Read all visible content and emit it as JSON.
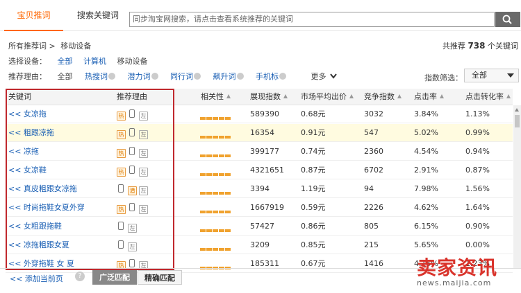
{
  "tabs": {
    "active": "宝贝推词",
    "inactive": "搜索关键词"
  },
  "search": {
    "placeholder": "同步淘宝网搜索，请点击查看系统推荐的关键词"
  },
  "breadcrumb": {
    "root": "所有推荐词 >",
    "current": "移动设备"
  },
  "total": {
    "prefix": "共推荐",
    "count": "738",
    "suffix": "个关键词"
  },
  "device": {
    "label": "选择设备：",
    "options": [
      "全部",
      "计算机",
      "移动设备"
    ]
  },
  "reason": {
    "label": "推荐理由：",
    "all": "全部",
    "options": [
      "热搜词",
      "潜力词",
      "同行词",
      "飙升词",
      "手机标"
    ],
    "more": "更多"
  },
  "index_filter": {
    "label": "指数筛选：",
    "value": "全部"
  },
  "columns": [
    "关键词",
    "推荐理由",
    "相关性",
    "展现指数",
    "市场平均出价",
    "竞争指数",
    "点击率",
    "点击转化率"
  ],
  "rows": [
    {
      "kw": "<< 女凉拖",
      "hot": true,
      "hot_label": "热",
      "pot": false,
      "impr": "589390",
      "bid": "0.68元",
      "comp": "3032",
      "ctr": "3.84%",
      "cvr": "1.13%",
      "hl": false
    },
    {
      "kw": "<< 粗跟凉拖",
      "hot": true,
      "hot_label": "热",
      "pot": false,
      "impr": "16354",
      "bid": "0.91元",
      "comp": "547",
      "ctr": "5.02%",
      "cvr": "0.99%",
      "hl": true
    },
    {
      "kw": "<< 凉拖",
      "hot": true,
      "hot_label": "热",
      "pot": false,
      "impr": "399177",
      "bid": "0.74元",
      "comp": "2360",
      "ctr": "4.54%",
      "cvr": "0.94%",
      "hl": false
    },
    {
      "kw": "<< 女凉鞋",
      "hot": true,
      "hot_label": "热",
      "pot": false,
      "impr": "4321651",
      "bid": "0.87元",
      "comp": "6702",
      "ctr": "2.91%",
      "cvr": "0.87%",
      "hl": false
    },
    {
      "kw": "<< 真皮粗跟女凉拖",
      "hot": false,
      "pot": true,
      "pot_label": "潜",
      "impr": "3394",
      "bid": "1.19元",
      "comp": "94",
      "ctr": "7.98%",
      "cvr": "1.56%",
      "hl": false
    },
    {
      "kw": "<< 时尚拖鞋女夏外穿",
      "hot": true,
      "hot_label": "热",
      "pot": false,
      "impr": "1667919",
      "bid": "0.59元",
      "comp": "2226",
      "ctr": "4.62%",
      "cvr": "1.64%",
      "hl": false
    },
    {
      "kw": "<< 女粗跟拖鞋",
      "hot": false,
      "pot": false,
      "impr": "57427",
      "bid": "0.86元",
      "comp": "805",
      "ctr": "6.15%",
      "cvr": "0.90%",
      "hl": false
    },
    {
      "kw": "<< 凉拖粗跟女夏",
      "hot": false,
      "pot": false,
      "impr": "3209",
      "bid": "0.85元",
      "comp": "215",
      "ctr": "5.65%",
      "cvr": "0.00%",
      "hl": false
    },
    {
      "kw": "<< 外穿拖鞋 女 夏",
      "hot": true,
      "hot_label": "热",
      "pot": false,
      "impr": "185311",
      "bid": "0.67元",
      "comp": "1416",
      "ctr": "4.15%",
      "cvr": "1.23%",
      "hl": false
    }
  ],
  "badge_left": "左",
  "footer": {
    "add": "<< 添加当前页",
    "help": "?",
    "broad": "广泛匹配",
    "exact": "精确匹配"
  },
  "watermark": {
    "main": "卖家资讯",
    "url": "news.maijia.com"
  },
  "colors": {
    "accent": "#ff6600",
    "link": "#1a5fb4",
    "highlight": "#fffbe0",
    "redbox": "#c0282d",
    "bar": "#f0a22e"
  }
}
